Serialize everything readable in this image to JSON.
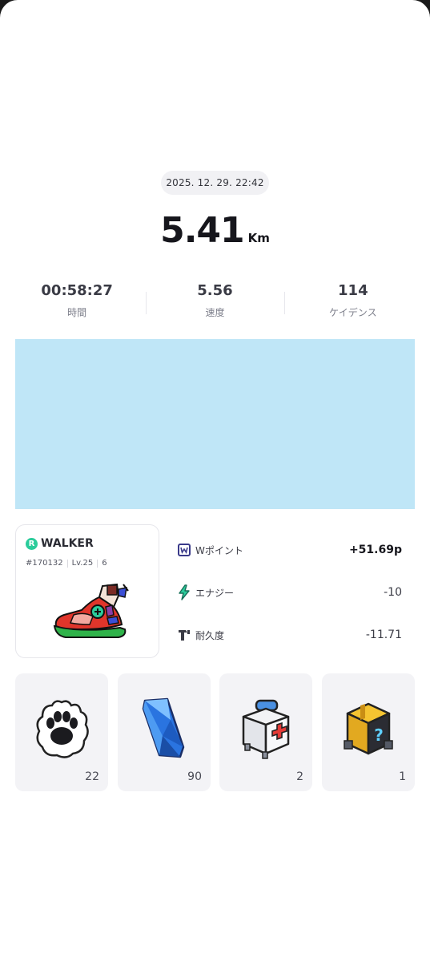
{
  "run": {
    "datetime": "2025. 12. 29. 22:42",
    "distance_value": "5.41",
    "distance_unit": "Km"
  },
  "stats": [
    {
      "value": "00:58:27",
      "label": "時間"
    },
    {
      "value": "5.56",
      "label": "速度"
    },
    {
      "value": "114",
      "label": "ケイデンス"
    }
  ],
  "shoe": {
    "brand_badge": "R",
    "brand": "WALKER",
    "id": "#170132",
    "level": "Lv.25",
    "mint_count": "6"
  },
  "rewards": [
    {
      "icon": "w-point-icon",
      "label": "Wポイント",
      "amount": "+51.69p"
    },
    {
      "icon": "energy-icon",
      "label": "エナジー",
      "amount": "-10"
    },
    {
      "icon": "durability-icon",
      "label": "耐久度",
      "amount": "-11.71"
    }
  ],
  "items": [
    {
      "icon": "paw-icon",
      "count": "22"
    },
    {
      "icon": "crystal-icon",
      "count": "90"
    },
    {
      "icon": "first-aid-kit-icon",
      "count": "2"
    },
    {
      "icon": "mystery-box-icon",
      "count": "1"
    }
  ],
  "colors": {
    "map_placeholder": "#bfe6f7",
    "brand_badge": "#2bcc9b",
    "energy": "#2bcc9b"
  }
}
